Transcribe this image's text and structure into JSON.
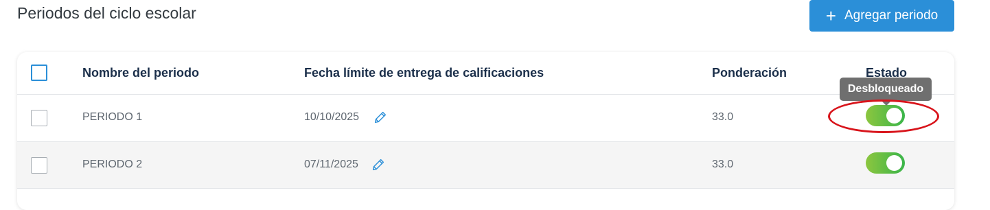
{
  "header": {
    "title": "Periodos del ciclo escolar",
    "add_button_label": "Agregar periodo",
    "add_button_icon": "plus-icon"
  },
  "table": {
    "columns": [
      "Nombre del periodo",
      "Fecha límite de entrega de calificaciones",
      "Ponderación",
      "Estado"
    ],
    "rows": [
      {
        "name": "PERIODO 1",
        "deadline": "10/10/2025",
        "weight": "33.0",
        "status_on": true
      },
      {
        "name": "PERIODO 2",
        "deadline": "07/11/2025",
        "weight": "33.0",
        "status_on": true
      }
    ]
  },
  "tooltip": {
    "text": "Desbloqueado"
  },
  "colors": {
    "primary": "#2b8fd8",
    "header_text": "#1b2f4a",
    "toggle_start": "#8cc63f",
    "toggle_end": "#3ab54a",
    "tooltip_bg": "#6f6f6f",
    "highlight": "#d8141b"
  }
}
